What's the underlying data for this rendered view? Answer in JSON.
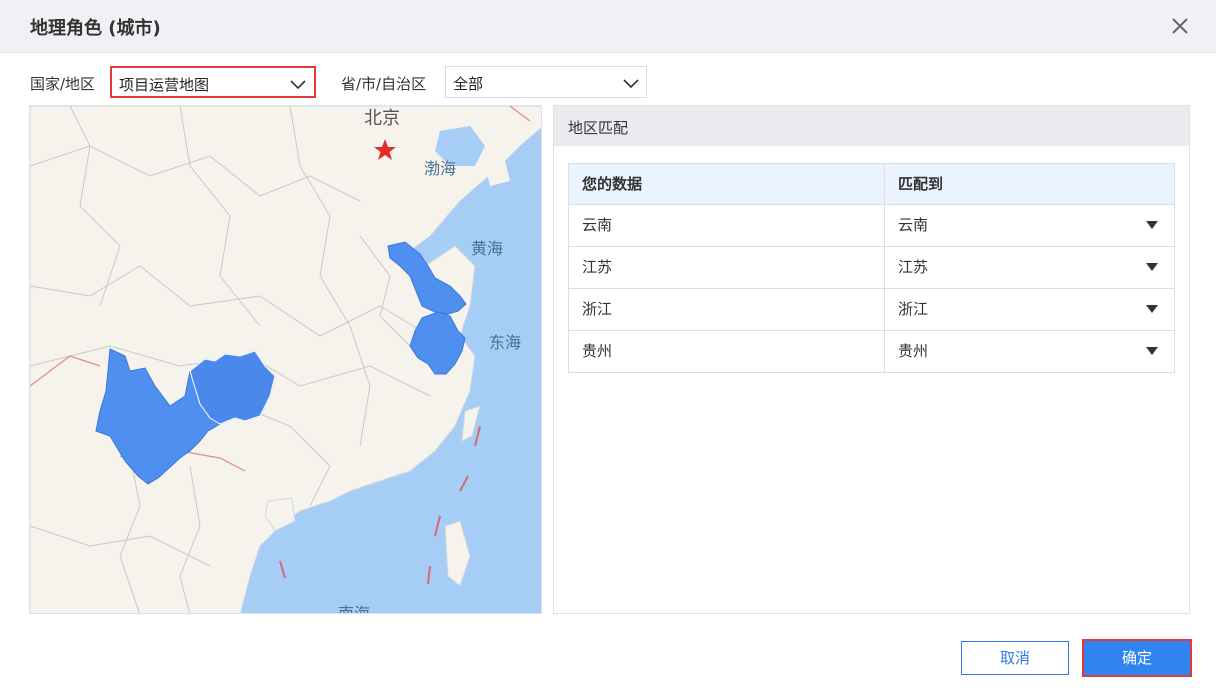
{
  "dialog": {
    "title": "地理角色 (城市)",
    "close_icon": "close-icon"
  },
  "filters": {
    "country_label": "国家/地区",
    "country_value": "项目运营地图",
    "province_label": "省/市/自治区",
    "province_value": "全部"
  },
  "map": {
    "labels": {
      "beijing": "北京",
      "bohai": "渤海",
      "huanghai": "黄海",
      "donghai": "东海",
      "nanhai": "南海"
    },
    "highlight_color": "#4f8ff0",
    "capital_icon": "red-star-icon",
    "highlighted_regions": [
      "云南",
      "贵州",
      "江苏",
      "浙江"
    ]
  },
  "match_panel": {
    "title": "地区匹配",
    "columns": [
      "您的数据",
      "匹配到"
    ],
    "rows": [
      {
        "data": "云南",
        "match": "云南"
      },
      {
        "data": "江苏",
        "match": "江苏"
      },
      {
        "data": "浙江",
        "match": "浙江"
      },
      {
        "data": "贵州",
        "match": "贵州"
      }
    ]
  },
  "buttons": {
    "cancel": "取消",
    "ok": "确定"
  },
  "colors": {
    "accent": "#2f84f0",
    "highlight_border": "#e03a3a",
    "sea": "#a5cdf6",
    "land": "#f6f3ec"
  }
}
